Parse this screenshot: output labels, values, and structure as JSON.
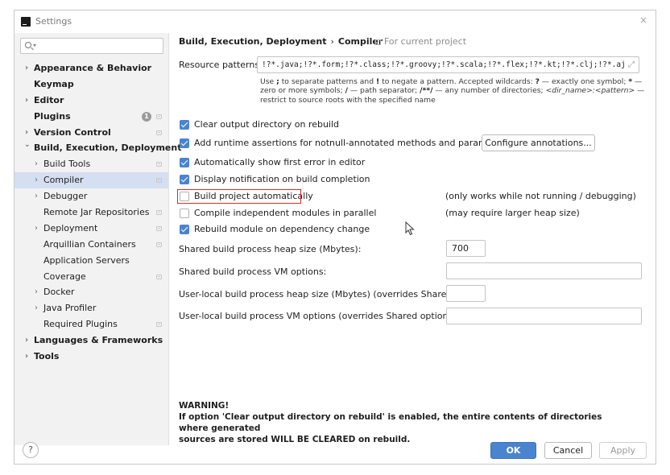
{
  "window": {
    "title": "Settings",
    "close": "×"
  },
  "search": {
    "placeholder": ""
  },
  "sidebar": {
    "items": [
      {
        "label": "Appearance & Behavior",
        "arrow": "›"
      },
      {
        "label": "Keymap",
        "arrow": ""
      },
      {
        "label": "Editor",
        "arrow": "›"
      },
      {
        "label": "Plugins",
        "arrow": "",
        "badge": "1"
      },
      {
        "label": "Version Control",
        "arrow": "›"
      },
      {
        "label": "Build, Execution, Deployment",
        "arrow": "⌄"
      },
      {
        "label": "Build Tools",
        "arrow": "›"
      },
      {
        "label": "Compiler",
        "arrow": "›"
      },
      {
        "label": "Debugger",
        "arrow": "›"
      },
      {
        "label": "Remote Jar Repositories",
        "arrow": ""
      },
      {
        "label": "Deployment",
        "arrow": "›"
      },
      {
        "label": "Arquillian Containers",
        "arrow": ""
      },
      {
        "label": "Application Servers",
        "arrow": ""
      },
      {
        "label": "Coverage",
        "arrow": ""
      },
      {
        "label": "Docker",
        "arrow": "›"
      },
      {
        "label": "Java Profiler",
        "arrow": "›"
      },
      {
        "label": "Required Plugins",
        "arrow": ""
      },
      {
        "label": "Languages & Frameworks",
        "arrow": "›"
      },
      {
        "label": "Tools",
        "arrow": "›"
      }
    ]
  },
  "header": {
    "breadcrumb_parent": "Build, Execution, Deployment",
    "breadcrumb_sep": "›",
    "breadcrumb_current": "Compiler",
    "for_current_project": "For current project"
  },
  "resource": {
    "label": "Resource patterns:",
    "value": "!?*.java;!?*.form;!?*.class;!?*.groovy;!?*.scala;!?*.flex;!?*.kt;!?*.clj;!?*.aj",
    "expand_glyph": "⤢",
    "help": {
      "use": "Use",
      "sep_sym": ";",
      "t1": " to separate patterns and ",
      "neg_sym": "!",
      "t2": " to negate a pattern. Accepted wildcards: ",
      "q_sym": "?",
      "t3": " — exactly one symbol; ",
      "star_sym": "*",
      "t4": " — zero or more symbols; ",
      "slash_sym": "/",
      "t5": " — path separator; ",
      "dstar_sym": "/**/",
      "t6": " — any number of directories; ",
      "pat": "<dir_name>:<pattern>",
      "t7": " — restrict to source roots with the specified name"
    }
  },
  "options": [
    {
      "label": "Clear output directory on rebuild",
      "checked": true
    },
    {
      "label": "Add runtime assertions for notnull-annotated methods and parameters",
      "checked": true
    },
    {
      "label": "Automatically show first error in editor",
      "checked": true
    },
    {
      "label": "Display notification on build completion",
      "checked": true
    },
    {
      "label": "Build project automatically",
      "checked": false,
      "note": "(only works while not running / debugging)"
    },
    {
      "label": "Compile independent modules in parallel",
      "checked": false,
      "note": "(may require larger heap size)"
    },
    {
      "label": "Rebuild module on dependency change",
      "checked": true
    }
  ],
  "configure_annotations": "Configure annotations...",
  "fields": [
    {
      "label": "Shared build process heap size (Mbytes):",
      "value": "700"
    },
    {
      "label": "Shared build process VM options:",
      "value": ""
    },
    {
      "label": "User-local build process heap size (Mbytes) (overrides Shared size):",
      "value": ""
    },
    {
      "label": "User-local build process VM options (overrides Shared options):",
      "value": ""
    }
  ],
  "warning": {
    "title": "WARNING!",
    "line1": "If option 'Clear output directory on rebuild' is enabled, the entire contents of directories where generated",
    "line2": "sources are stored WILL BE CLEARED on rebuild."
  },
  "footer": {
    "help": "?",
    "ok": "OK",
    "cancel": "Cancel",
    "apply": "Apply"
  },
  "colors": {
    "accent": "#4a84cf",
    "selection": "#d4dff1",
    "highlight_border": "#d92b2b",
    "sidebar_bg": "#f2f2f2"
  }
}
